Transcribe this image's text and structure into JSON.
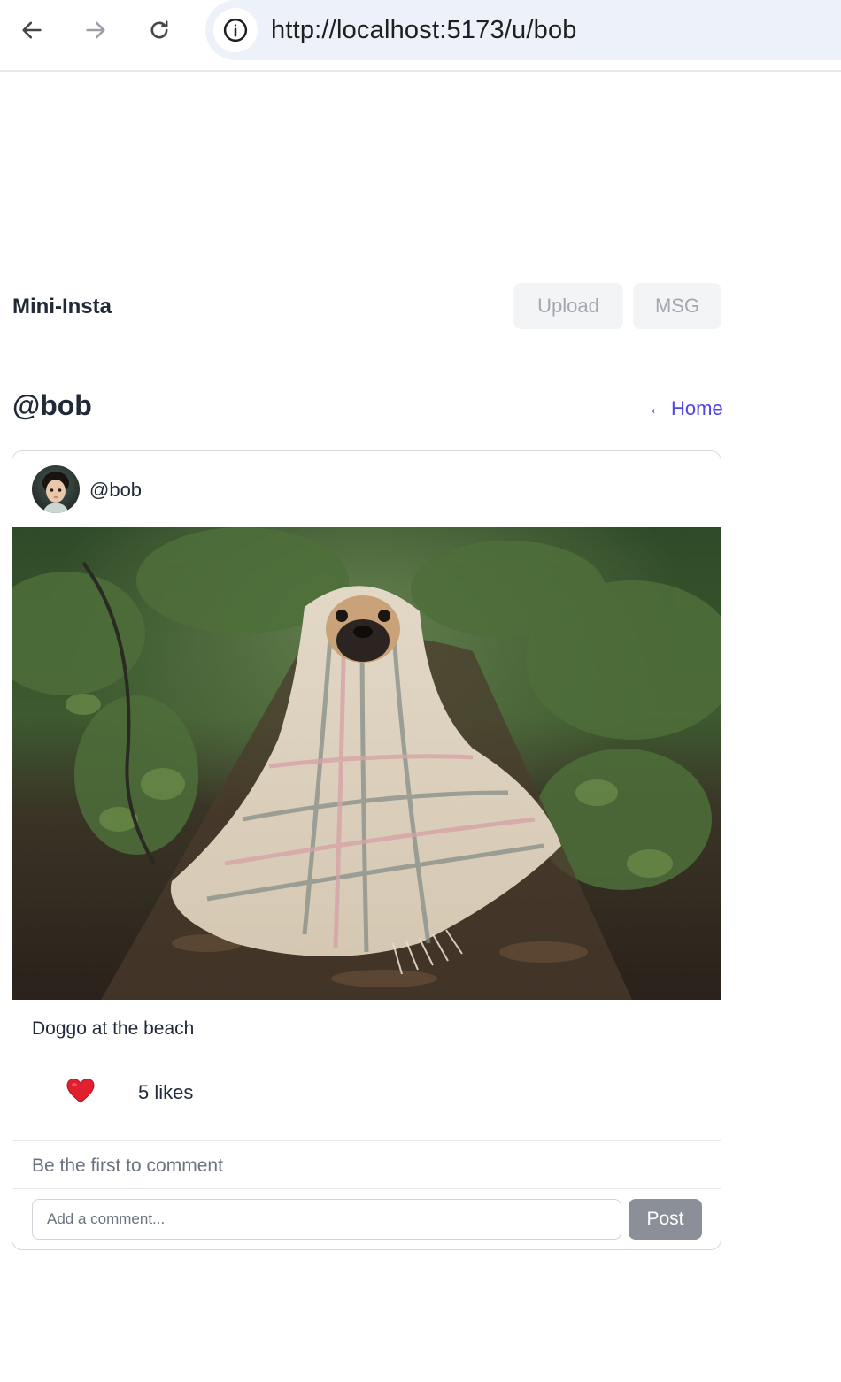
{
  "browser": {
    "url": "http://localhost:5173/u/bob",
    "back_icon": "arrow-left-icon",
    "forward_icon": "arrow-right-icon",
    "reload_icon": "reload-icon",
    "site_info_icon": "info-icon"
  },
  "header": {
    "brand": "Mini-Insta",
    "upload_label": "Upload",
    "msg_label": "MSG"
  },
  "profile": {
    "title": "@bob",
    "home_link_arrow": "←",
    "home_link_label": "Home"
  },
  "post": {
    "username": "@bob",
    "caption": "Doggo at the beach",
    "likes_text": "5 likes",
    "like_icon": "heart-icon",
    "like_color": "#e0202e",
    "comments_empty_text": "Be the first to comment",
    "comment_placeholder": "Add a comment...",
    "post_button_label": "Post"
  },
  "colors": {
    "accent": "#4f46e5",
    "post_button": "#8b8f97",
    "header_button_bg": "#f3f4f6"
  }
}
